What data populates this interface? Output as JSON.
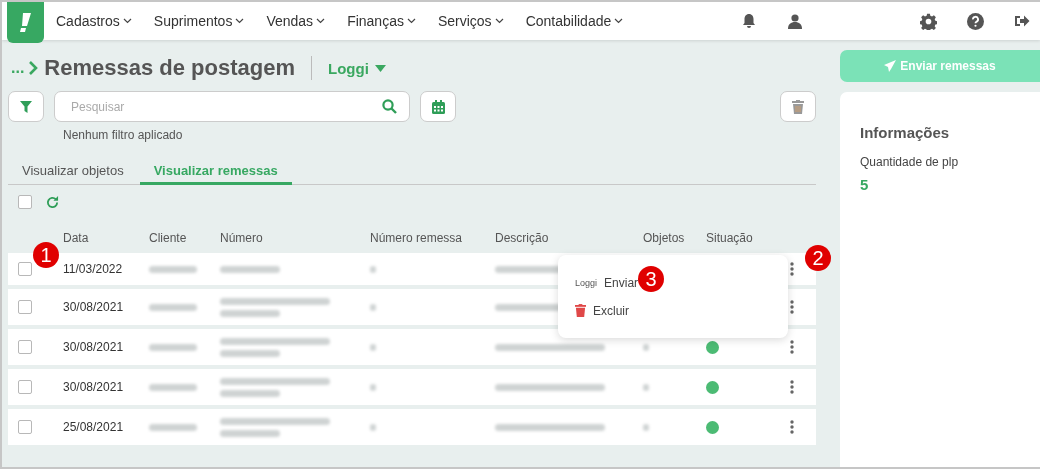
{
  "nav": {
    "menus": [
      "Cadastros",
      "Suprimentos",
      "Vendas",
      "Finanças",
      "Serviços",
      "Contabilidade"
    ]
  },
  "page": {
    "breadcrumb": "...",
    "title": "Remessas de postagem",
    "carrier": "Loggi"
  },
  "search": {
    "placeholder": "Pesquisar"
  },
  "filter_status": "Nenhum filtro aplicado",
  "tabs": [
    {
      "label": "Visualizar objetos",
      "selected": false
    },
    {
      "label": "Visualizar remessas",
      "selected": true
    }
  ],
  "table": {
    "select_all": {
      "checked": false
    },
    "columns": [
      "Data",
      "Cliente",
      "Número",
      "Número remessa",
      "Descrição",
      "Objetos",
      "Situação"
    ],
    "rows": [
      {
        "date": "11/03/2022",
        "checked": false,
        "number_wrapped": false
      },
      {
        "date": "30/08/2021",
        "checked": false,
        "number_wrapped": true
      },
      {
        "date": "30/08/2021",
        "checked": false,
        "number_wrapped": true,
        "status_ok": true
      },
      {
        "date": "30/08/2021",
        "checked": false,
        "number_wrapped": true,
        "status_ok": true
      },
      {
        "date": "25/08/2021",
        "checked": false,
        "number_wrapped": true,
        "status_ok": true
      }
    ]
  },
  "row_menu": {
    "items": [
      {
        "kind": "logo",
        "logo": "Loggi",
        "label": "Enviar"
      },
      {
        "kind": "trash",
        "label": "Excluir"
      }
    ]
  },
  "send_button": "Enviar remessas",
  "info": {
    "title": "Informações",
    "label": "Quantidade de plp",
    "value": "5"
  },
  "callouts": [
    "1",
    "2",
    "3"
  ]
}
